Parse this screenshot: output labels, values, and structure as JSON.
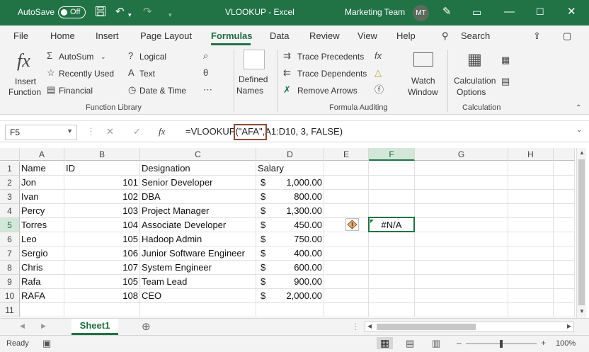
{
  "titlebar": {
    "autosave_label": "AutoSave",
    "autosave_state": "Off",
    "doc_title": "VLOOKUP",
    "app_name": "Excel",
    "separator": "-",
    "team": "Marketing Team",
    "avatar_initials": "MT"
  },
  "tabs": [
    "File",
    "Home",
    "Insert",
    "Page Layout",
    "Formulas",
    "Data",
    "Review",
    "View",
    "Help"
  ],
  "search_label": "Search",
  "ribbon": {
    "insert_function": [
      "Insert",
      "Function"
    ],
    "autosum": "AutoSum",
    "recently_used": "Recently Used",
    "financial": "Financial",
    "logical": "Logical",
    "text": "Text",
    "date_time": "Date & Time",
    "defined_names": [
      "Defined",
      "Names"
    ],
    "trace_precedents": "Trace Precedents",
    "trace_dependents": "Trace Dependents",
    "remove_arrows": "Remove Arrows",
    "watch_window": [
      "Watch",
      "Window"
    ],
    "calculation_options": [
      "Calculation",
      "Options"
    ],
    "groups": {
      "function_library": "Function Library",
      "formula_auditing": "Formula Auditing",
      "calculation": "Calculation"
    }
  },
  "formula_bar": {
    "name_box": "F5",
    "fx": "fx",
    "formula_prefix": "=VLOOKUP",
    "formula_highlight": "(\"AFA\"",
    "formula_suffix": ",A1:D10, 3, FALSE)"
  },
  "columns": [
    "A",
    "B",
    "C",
    "D",
    "E",
    "F",
    "G",
    "H"
  ],
  "rows": [
    {
      "n": "1",
      "a": "Name",
      "b": "ID",
      "c": "Designation",
      "d_sym": "",
      "d": "Salary"
    },
    {
      "n": "2",
      "a": "Jon",
      "b": "101",
      "c": "Senior Developer",
      "d_sym": "$",
      "d": "1,000.00"
    },
    {
      "n": "3",
      "a": "Ivan",
      "b": "102",
      "c": "DBA",
      "d_sym": "$",
      "d": "800.00"
    },
    {
      "n": "4",
      "a": "Percy",
      "b": "103",
      "c": "Project Manager",
      "d_sym": "$",
      "d": "1,300.00"
    },
    {
      "n": "5",
      "a": "Torres",
      "b": "104",
      "c": "Associate Developer",
      "d_sym": "$",
      "d": "450.00"
    },
    {
      "n": "6",
      "a": "Leo",
      "b": "105",
      "c": "Hadoop Admin",
      "d_sym": "$",
      "d": "750.00"
    },
    {
      "n": "7",
      "a": "Sergio",
      "b": "106",
      "c": "Junior Software Engineer",
      "d_sym": "$",
      "d": "400.00"
    },
    {
      "n": "8",
      "a": "Chris",
      "b": "107",
      "c": "System Engineer",
      "d_sym": "$",
      "d": "600.00"
    },
    {
      "n": "9",
      "a": "Rafa",
      "b": "105",
      "c": "Team Lead",
      "d_sym": "$",
      "d": "900.00"
    },
    {
      "n": "10",
      "a": "RAFA",
      "b": "108",
      "c": "CEO",
      "d_sym": "$",
      "d": "2,000.00"
    },
    {
      "n": "11",
      "a": "",
      "b": "",
      "c": "",
      "d_sym": "",
      "d": ""
    }
  ],
  "f5_value": "#N/A",
  "sheet_tab": "Sheet1",
  "status": {
    "ready": "Ready",
    "zoom": "100%"
  },
  "colors": {
    "brand": "#217346",
    "error_box": "#8b4a3a"
  }
}
